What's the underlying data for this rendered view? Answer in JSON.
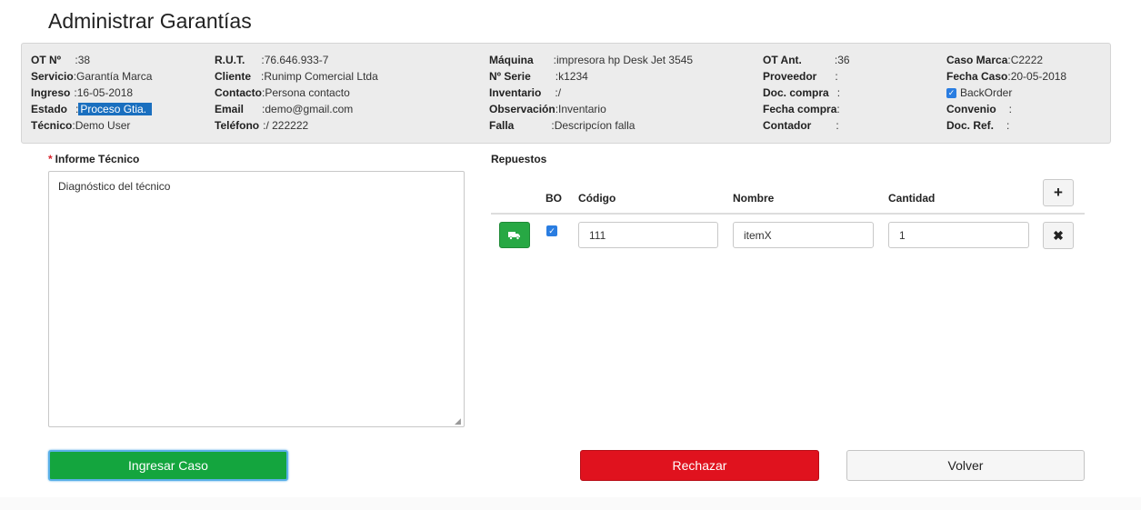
{
  "page": {
    "title": "Administrar Garantías"
  },
  "info": {
    "col1": [
      {
        "label": "OT Nº",
        "value": "38"
      },
      {
        "label": "Servicio",
        "value": "Garantía Marca"
      },
      {
        "label": "Ingreso",
        "value": "16-05-2018"
      },
      {
        "label": "Estado",
        "value": "Proceso Gtia."
      },
      {
        "label": "Técnico",
        "value": "Demo User"
      }
    ],
    "col2": [
      {
        "label": "R.U.T.",
        "value": "76.646.933-7"
      },
      {
        "label": "Cliente",
        "value": "Runimp Comercial Ltda"
      },
      {
        "label": "Contacto",
        "value": "Persona contacto"
      },
      {
        "label": "Email",
        "value": "demo@gmail.com"
      },
      {
        "label": "Teléfono",
        "value": "/ 222222"
      }
    ],
    "col3": [
      {
        "label": "Máquina",
        "value": "impresora hp Desk Jet 3545"
      },
      {
        "label": "Nº Serie",
        "value": "k1234"
      },
      {
        "label": "Inventario",
        "value": "/"
      },
      {
        "label": "Observación",
        "value": "Inventario"
      },
      {
        "label": "Falla",
        "value": "Descripcíon falla"
      }
    ],
    "col4": [
      {
        "label": "OT Ant.",
        "value": "36"
      },
      {
        "label": "Proveedor",
        "value": ""
      },
      {
        "label": "Doc. compra",
        "value": ""
      },
      {
        "label": "Fecha compra",
        "value": ""
      },
      {
        "label": "Contador",
        "value": ""
      }
    ],
    "col5": {
      "caso_marca": {
        "label": "Caso Marca",
        "value": "C2222"
      },
      "fecha_caso": {
        "label": "Fecha Caso",
        "value": "20-05-2018"
      },
      "backorder": {
        "label": "BackOrder",
        "checked": true
      },
      "convenio": {
        "label": "Convenio",
        "value": ""
      },
      "doc_ref": {
        "label": "Doc. Ref.",
        "value": ""
      }
    },
    "separator": ":"
  },
  "report": {
    "label": "Informe Técnico",
    "required_mark": "*",
    "value": "Diagnóstico del técnico"
  },
  "parts": {
    "label": "Repuestos",
    "headers": {
      "bo": "BO",
      "codigo": "Código",
      "nombre": "Nombre",
      "cantidad": "Cantidad"
    },
    "add_icon": "plus-icon",
    "rows": [
      {
        "bo": true,
        "codigo": "111",
        "nombre": "itemX",
        "cantidad": "1"
      }
    ]
  },
  "actions": {
    "ingresar": "Ingresar Caso",
    "rechazar": "Rechazar",
    "volver": "Volver"
  },
  "colors": {
    "green": "#14a53e",
    "red": "#e0121e",
    "highlight": "#1a6fbf",
    "checkbox": "#2a7de1"
  }
}
